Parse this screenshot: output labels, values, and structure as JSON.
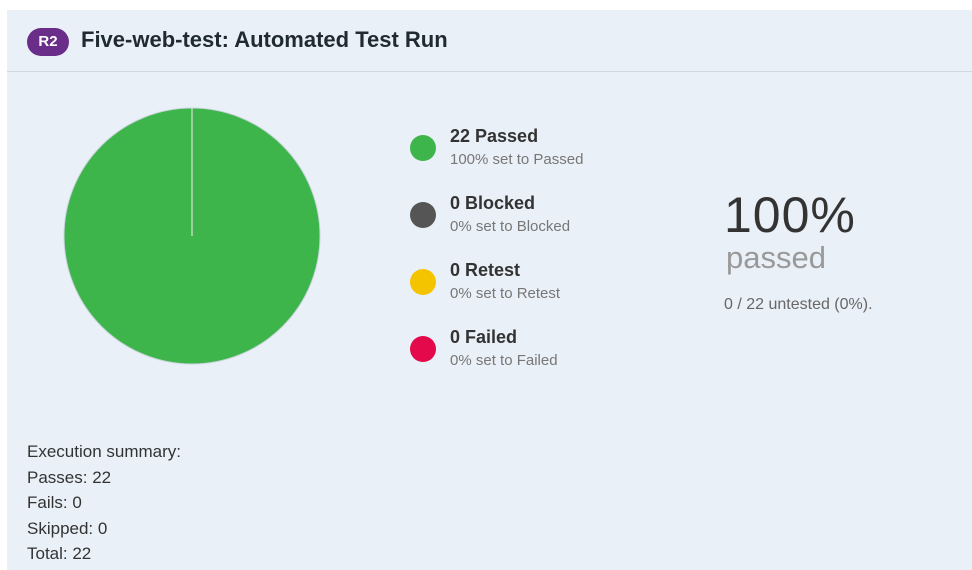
{
  "header": {
    "badge": "R2",
    "title": "Five-web-test: Automated Test Run"
  },
  "chart_data": {
    "type": "pie",
    "categories": [
      "Passed",
      "Blocked",
      "Retest",
      "Failed"
    ],
    "values": [
      22,
      0,
      0,
      0
    ],
    "colors": [
      "#3db54a",
      "#555555",
      "#f5c400",
      "#e3094a"
    ]
  },
  "legend": [
    {
      "count": "22 Passed",
      "sub": "100% set to Passed",
      "color": "#3db54a"
    },
    {
      "count": "0 Blocked",
      "sub": "0% set to Blocked",
      "color": "#555555"
    },
    {
      "count": "0 Retest",
      "sub": "0% set to Retest",
      "color": "#f5c400"
    },
    {
      "count": "0 Failed",
      "sub": "0% set to Failed",
      "color": "#e3094a"
    }
  ],
  "stats": {
    "percent": "100%",
    "percent_label": "passed",
    "untested": "0 / 22 untested (0%)."
  },
  "summary": {
    "heading": "Execution summary:",
    "passes": "Passes: 22",
    "fails": "Fails: 0",
    "skipped": "Skipped: 0",
    "total": "Total: 22"
  }
}
